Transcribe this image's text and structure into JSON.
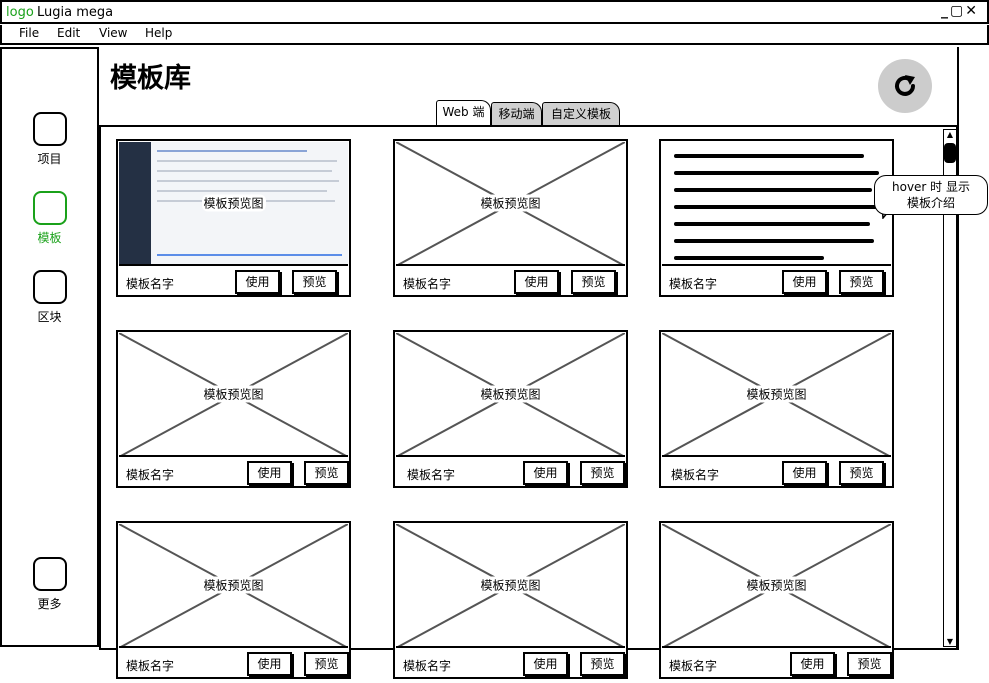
{
  "window": {
    "logo": "logo",
    "title": "Lugia mega",
    "controls": "_▢✕"
  },
  "menu": [
    "File",
    "Edit",
    "View",
    "Help"
  ],
  "sidebar": {
    "items": [
      {
        "label": "项目",
        "active": false
      },
      {
        "label": "模板",
        "active": true
      },
      {
        "label": "区块",
        "active": false
      },
      {
        "label": "更多",
        "active": false
      }
    ]
  },
  "page": {
    "title": "模板库",
    "refresh_icon": "refresh-icon"
  },
  "tabs": [
    {
      "label": "Web 端",
      "active": true
    },
    {
      "label": "移动端",
      "active": false
    },
    {
      "label": "自定义模板",
      "active": false
    }
  ],
  "card_text": {
    "preview_label": "模板预览图",
    "name": "模板名字",
    "use": "使用",
    "preview": "预览"
  },
  "cards": [
    {
      "type": "screenshot"
    },
    {
      "type": "placeholder"
    },
    {
      "type": "text"
    },
    {
      "type": "placeholder"
    },
    {
      "type": "placeholder"
    },
    {
      "type": "placeholder"
    },
    {
      "type": "placeholder"
    },
    {
      "type": "placeholder"
    },
    {
      "type": "placeholder"
    }
  ],
  "tooltip": {
    "line1": "hover 时 显示",
    "line2": "模板介绍"
  },
  "colors": {
    "accent": "#1aa11a",
    "tab_inactive": "#d0d0d0",
    "refresh_bg": "#cccccc"
  }
}
